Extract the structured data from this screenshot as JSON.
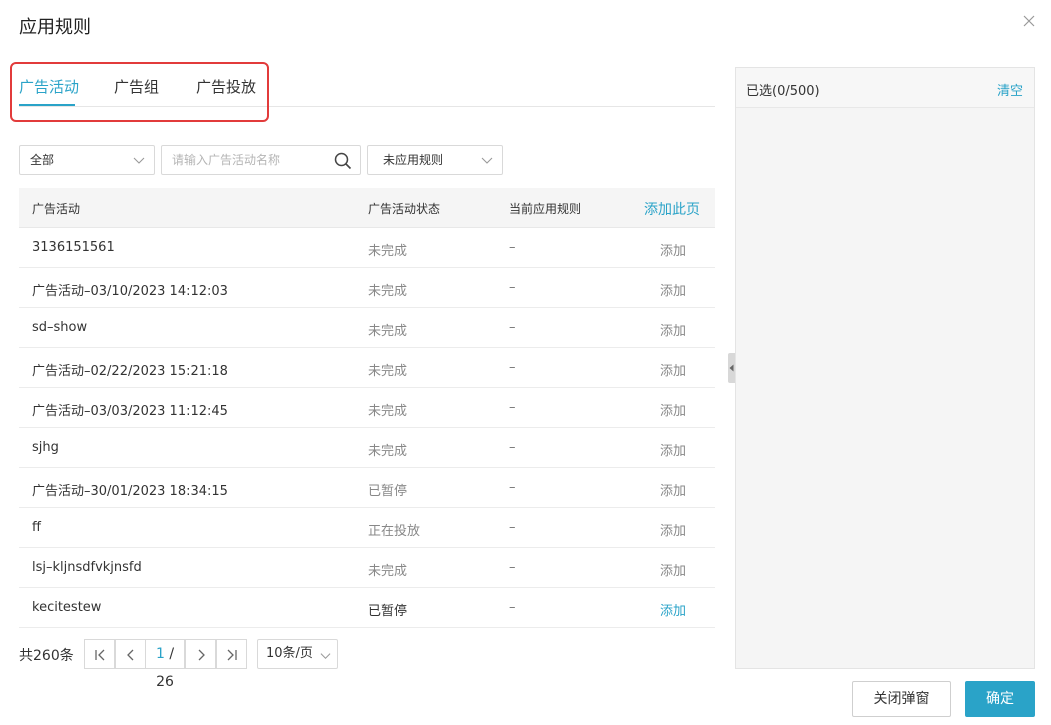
{
  "dialog": {
    "title": "应用规则"
  },
  "tabs": [
    {
      "label": "广告活动",
      "active": true
    },
    {
      "label": "广告组",
      "active": false
    },
    {
      "label": "广告投放",
      "active": false
    }
  ],
  "filters": {
    "scope_select": "全部",
    "search_placeholder": "请输入广告活动名称",
    "rule_select": "未应用规则"
  },
  "table": {
    "headers": {
      "name": "广告活动",
      "status": "广告活动状态",
      "rule": "当前应用规则",
      "add_page": "添加此页"
    },
    "rows": [
      {
        "name": "3136151561",
        "status": "未完成",
        "rule": "–",
        "action": "添加"
      },
      {
        "name": "广告活动–03/10/2023 14:12:03",
        "status": "未完成",
        "rule": "–",
        "action": "添加"
      },
      {
        "name": "sd–show",
        "status": "未完成",
        "rule": "–",
        "action": "添加"
      },
      {
        "name": "广告活动–02/22/2023 15:21:18",
        "status": "未完成",
        "rule": "–",
        "action": "添加"
      },
      {
        "name": "广告活动–03/03/2023 11:12:45",
        "status": "未完成",
        "rule": "–",
        "action": "添加"
      },
      {
        "name": "sjhg",
        "status": "未完成",
        "rule": "–",
        "action": "添加"
      },
      {
        "name": "广告活动–30/01/2023 18:34:15",
        "status": "已暂停",
        "rule": "–",
        "action": "添加"
      },
      {
        "name": "ff",
        "status": "正在投放",
        "rule": "–",
        "action": "添加"
      },
      {
        "name": "lsj–kljnsdfvkjnsfd",
        "status": "未完成",
        "rule": "–",
        "action": "添加"
      },
      {
        "name": "kecitestew",
        "status": "已暂停",
        "rule": "–",
        "action": "添加",
        "hover": true
      }
    ]
  },
  "pagination": {
    "total": "共260条",
    "current": "1",
    "total_pages": "/ 26",
    "page_size": "10条/页"
  },
  "selected_panel": {
    "count": "已选(0/500)",
    "clear": "清空"
  },
  "footer": {
    "cancel": "关闭弹窗",
    "confirm": "确定"
  },
  "colors": {
    "accent": "#2aa3c8",
    "highlight": "#e23b3b"
  },
  "icons": [
    "close-icon",
    "chevron-down-icon",
    "search-icon",
    "first-page-icon",
    "prev-page-icon",
    "next-page-icon",
    "last-page-icon",
    "collapse-arrow-icon"
  ]
}
